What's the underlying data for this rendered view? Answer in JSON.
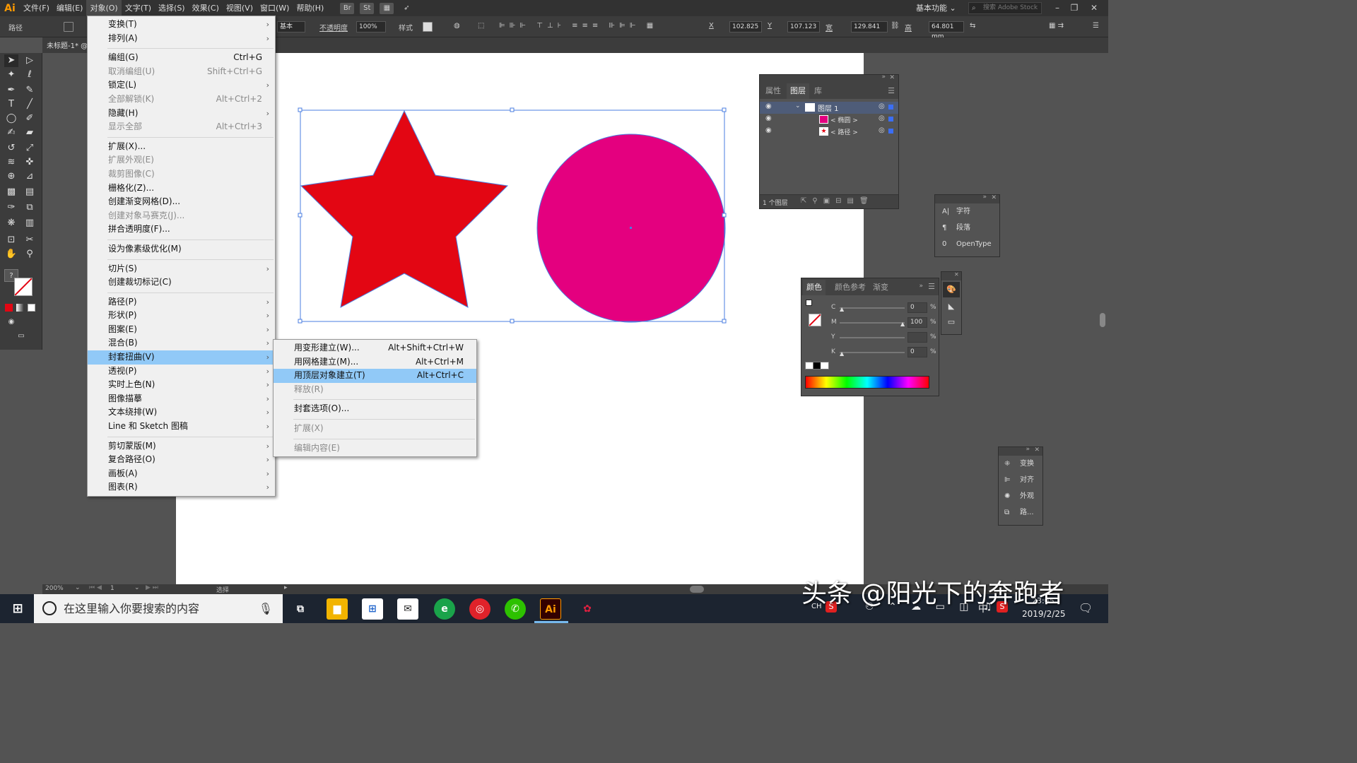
{
  "app": {
    "logo": "Ai"
  },
  "menubar": {
    "items": [
      "文件(F)",
      "编辑(E)",
      "对象(O)",
      "文字(T)",
      "选择(S)",
      "效果(C)",
      "视图(V)",
      "窗口(W)",
      "帮助(H)"
    ],
    "icons": [
      "Br",
      "St"
    ]
  },
  "workspace": {
    "label": "基本功能",
    "stock_search": "搜索 Adobe Stock"
  },
  "control": {
    "selection_type": "路径",
    "stroke_profile": "基本",
    "opacity_label": "不透明度",
    "opacity_value": "100%",
    "style_label": "样式",
    "x_label": "X",
    "x_value": "102.825",
    "y_label": "Y",
    "y_value": "107.123",
    "w_label": "宽",
    "w_value": "129.841",
    "h_label": "高",
    "h_value": "64.801 mm"
  },
  "document": {
    "tab": "未标题-1* @"
  },
  "object_menu": [
    {
      "label": "变换(T)",
      "sc": "",
      "sub": true,
      "dis": false
    },
    {
      "label": "排列(A)",
      "sc": "",
      "sub": true,
      "dis": false
    },
    {
      "sep": true
    },
    {
      "label": "编组(G)",
      "sc": "Ctrl+G",
      "sub": false,
      "dis": false
    },
    {
      "label": "取消编组(U)",
      "sc": "Shift+Ctrl+G",
      "sub": false,
      "dis": true
    },
    {
      "label": "锁定(L)",
      "sc": "",
      "sub": true,
      "dis": false
    },
    {
      "label": "全部解锁(K)",
      "sc": "Alt+Ctrl+2",
      "sub": false,
      "dis": true
    },
    {
      "label": "隐藏(H)",
      "sc": "",
      "sub": true,
      "dis": false
    },
    {
      "label": "显示全部",
      "sc": "Alt+Ctrl+3",
      "sub": false,
      "dis": true
    },
    {
      "sep": true
    },
    {
      "label": "扩展(X)...",
      "sc": "",
      "sub": false,
      "dis": false
    },
    {
      "label": "扩展外观(E)",
      "sc": "",
      "sub": false,
      "dis": true
    },
    {
      "label": "裁剪图像(C)",
      "sc": "",
      "sub": false,
      "dis": true
    },
    {
      "label": "栅格化(Z)...",
      "sc": "",
      "sub": false,
      "dis": false
    },
    {
      "label": "创建渐变网格(D)...",
      "sc": "",
      "sub": false,
      "dis": false
    },
    {
      "label": "创建对象马赛克(J)...",
      "sc": "",
      "sub": false,
      "dis": true
    },
    {
      "label": "拼合透明度(F)...",
      "sc": "",
      "sub": false,
      "dis": false
    },
    {
      "sep": true
    },
    {
      "label": "设为像素级优化(M)",
      "sc": "",
      "sub": false,
      "dis": false
    },
    {
      "sep": true
    },
    {
      "label": "切片(S)",
      "sc": "",
      "sub": true,
      "dis": false
    },
    {
      "label": "创建裁切标记(C)",
      "sc": "",
      "sub": false,
      "dis": false
    },
    {
      "sep": true
    },
    {
      "label": "路径(P)",
      "sc": "",
      "sub": true,
      "dis": false
    },
    {
      "label": "形状(P)",
      "sc": "",
      "sub": true,
      "dis": false
    },
    {
      "label": "图案(E)",
      "sc": "",
      "sub": true,
      "dis": false
    },
    {
      "label": "混合(B)",
      "sc": "",
      "sub": true,
      "dis": false
    },
    {
      "label": "封套扭曲(V)",
      "sc": "",
      "sub": true,
      "dis": false,
      "hl": true
    },
    {
      "label": "透视(P)",
      "sc": "",
      "sub": true,
      "dis": false
    },
    {
      "label": "实时上色(N)",
      "sc": "",
      "sub": true,
      "dis": false
    },
    {
      "label": "图像描摹",
      "sc": "",
      "sub": true,
      "dis": false
    },
    {
      "label": "文本绕排(W)",
      "sc": "",
      "sub": true,
      "dis": false
    },
    {
      "label": "Line 和 Sketch 图稿",
      "sc": "",
      "sub": true,
      "dis": false
    },
    {
      "sep": true
    },
    {
      "label": "剪切蒙版(M)",
      "sc": "",
      "sub": true,
      "dis": false
    },
    {
      "label": "复合路径(O)",
      "sc": "",
      "sub": true,
      "dis": false
    },
    {
      "label": "画板(A)",
      "sc": "",
      "sub": true,
      "dis": false
    },
    {
      "label": "图表(R)",
      "sc": "",
      "sub": true,
      "dis": false
    }
  ],
  "envelope_menu": [
    {
      "label": "用变形建立(W)...",
      "sc": "Alt+Shift+Ctrl+W",
      "dis": false
    },
    {
      "label": "用网格建立(M)...",
      "sc": "Alt+Ctrl+M",
      "dis": false
    },
    {
      "label": "用顶层对象建立(T)",
      "sc": "Alt+Ctrl+C",
      "dis": false,
      "hl": true
    },
    {
      "label": "释放(R)",
      "sc": "",
      "dis": true
    },
    {
      "sep": true
    },
    {
      "label": "封套选项(O)...",
      "sc": "",
      "dis": false
    },
    {
      "sep": true
    },
    {
      "label": "扩展(X)",
      "sc": "",
      "dis": true
    },
    {
      "sep": true
    },
    {
      "label": "编辑内容(E)",
      "sc": "",
      "dis": true
    }
  ],
  "layers_panel": {
    "tabs": [
      "属性",
      "图层",
      "库"
    ],
    "layer_name": "图层 1",
    "items": [
      "< 椭圆 >",
      "< 路径 >"
    ],
    "footer": "1 个图层"
  },
  "char_panel": {
    "items": [
      "字符",
      "段落",
      "OpenType"
    ]
  },
  "color_panel": {
    "tabs": [
      "颜色",
      "颜色参考",
      "渐变"
    ],
    "channels": [
      {
        "name": "C",
        "value": "0"
      },
      {
        "name": "M",
        "value": "100"
      },
      {
        "name": "Y",
        "value": ""
      },
      {
        "name": "K",
        "value": "0"
      }
    ],
    "unit": "%"
  },
  "transform_panel": {
    "items": [
      "变换",
      "对齐",
      "外观",
      "路..."
    ]
  },
  "status": {
    "zoom": "200%",
    "artboard": "1",
    "tool": "选择"
  },
  "taskbar": {
    "search_placeholder": "在这里输入你要搜索的内容",
    "ime": "中",
    "ime2": "CH",
    "time": "23:05",
    "date": "2019/2/25",
    "watermark": "头条 @阳光下的奔跑者"
  },
  "colors": {
    "star": "#e30613",
    "circle": "#e4007f",
    "selection": "#4a7de0",
    "menu_highlight": "#91c9f7"
  }
}
